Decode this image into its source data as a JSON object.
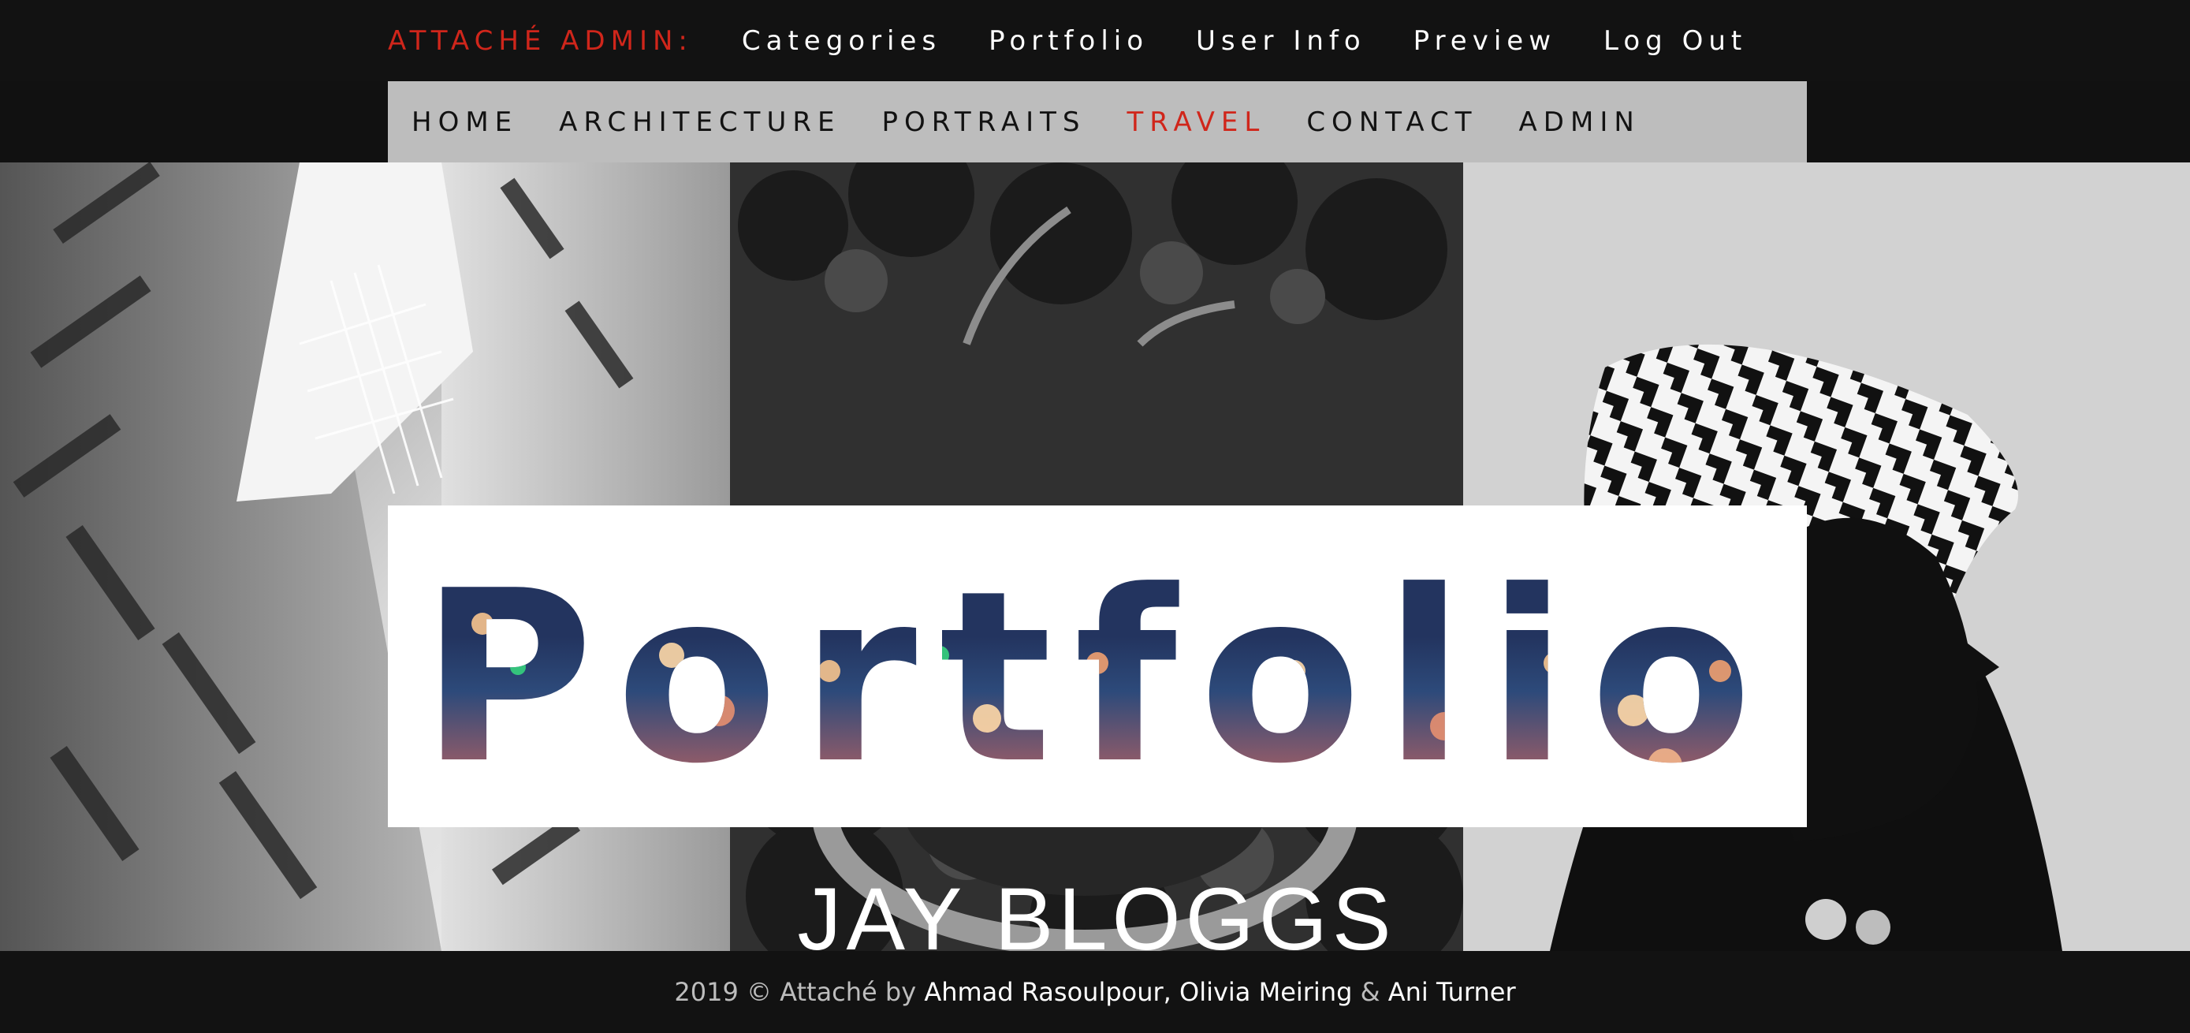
{
  "admin_bar": {
    "label": "ATTACHÉ ADMIN:",
    "links": [
      "Categories",
      "Portfolio",
      "User Info",
      "Preview",
      "Log Out"
    ]
  },
  "main_nav": {
    "items": [
      "HOME",
      "ARCHITECTURE",
      "PORTRAITS",
      "TRAVEL",
      "CONTACT",
      "ADMIN"
    ],
    "active": "TRAVEL"
  },
  "hero": {
    "title": "Portfolio",
    "subtitle": "JAY BLOGGS"
  },
  "footer": {
    "prefix": "2019 © Attaché by",
    "author1": "Ahmad Rasoulpour",
    "sep1": ",",
    "author2": "Olivia Meiring",
    "sep2": "&",
    "author3": "Ani Turner"
  },
  "colors": {
    "accent": "#d0261b",
    "nav_background": "#bdbdbd",
    "bar_background": "#121212",
    "title_navy": "#23345f"
  }
}
